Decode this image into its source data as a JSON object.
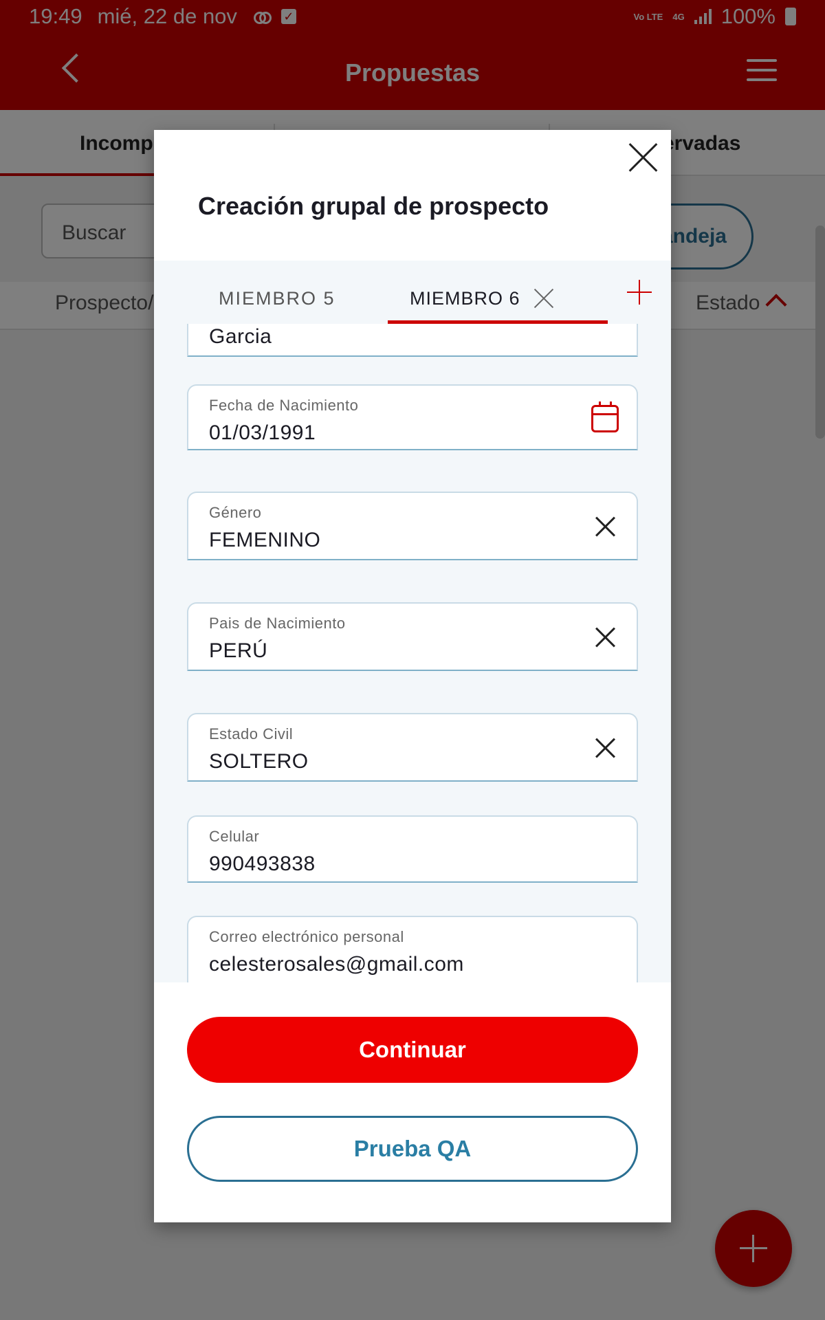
{
  "status_bar": {
    "time": "19:49",
    "date": "mié, 22 de nov",
    "volte": "Vo LTE",
    "network": "4G",
    "battery": "100%"
  },
  "app_bar": {
    "title": "Propuestas"
  },
  "background_tabs": {
    "left_tab": "Incompl",
    "right_tab": "ervadas"
  },
  "search": {
    "placeholder": "Buscar",
    "bandeja_label": "andeja"
  },
  "columns": {
    "prospecto": "Prospecto/",
    "estado": "Estado"
  },
  "modal": {
    "title": "Creación grupal de prospecto",
    "member_tabs": [
      {
        "label": "MIEMBRO 5"
      },
      {
        "label": "MIEMBRO 6"
      }
    ],
    "fields": {
      "apellido": {
        "value": "Garcia"
      },
      "fecha_nacimiento": {
        "label": "Fecha de Nacimiento",
        "value": "01/03/1991"
      },
      "genero": {
        "label": "Género",
        "value": "FEMENINO"
      },
      "pais_nacimiento": {
        "label": "Pais de Nacimiento",
        "value": "PERÚ"
      },
      "estado_civil": {
        "label": "Estado Civil",
        "value": "SOLTERO"
      },
      "celular": {
        "label": "Celular",
        "value": "990493838"
      },
      "correo": {
        "label": "Correo electrónico personal",
        "value": "celesterosales@gmail.com"
      }
    },
    "continue_label": "Continuar",
    "qa_label": "Prueba QA"
  },
  "colors": {
    "brand_red": "#cc0000",
    "button_red": "#ee0000",
    "accent_blue": "#2a6f92"
  }
}
